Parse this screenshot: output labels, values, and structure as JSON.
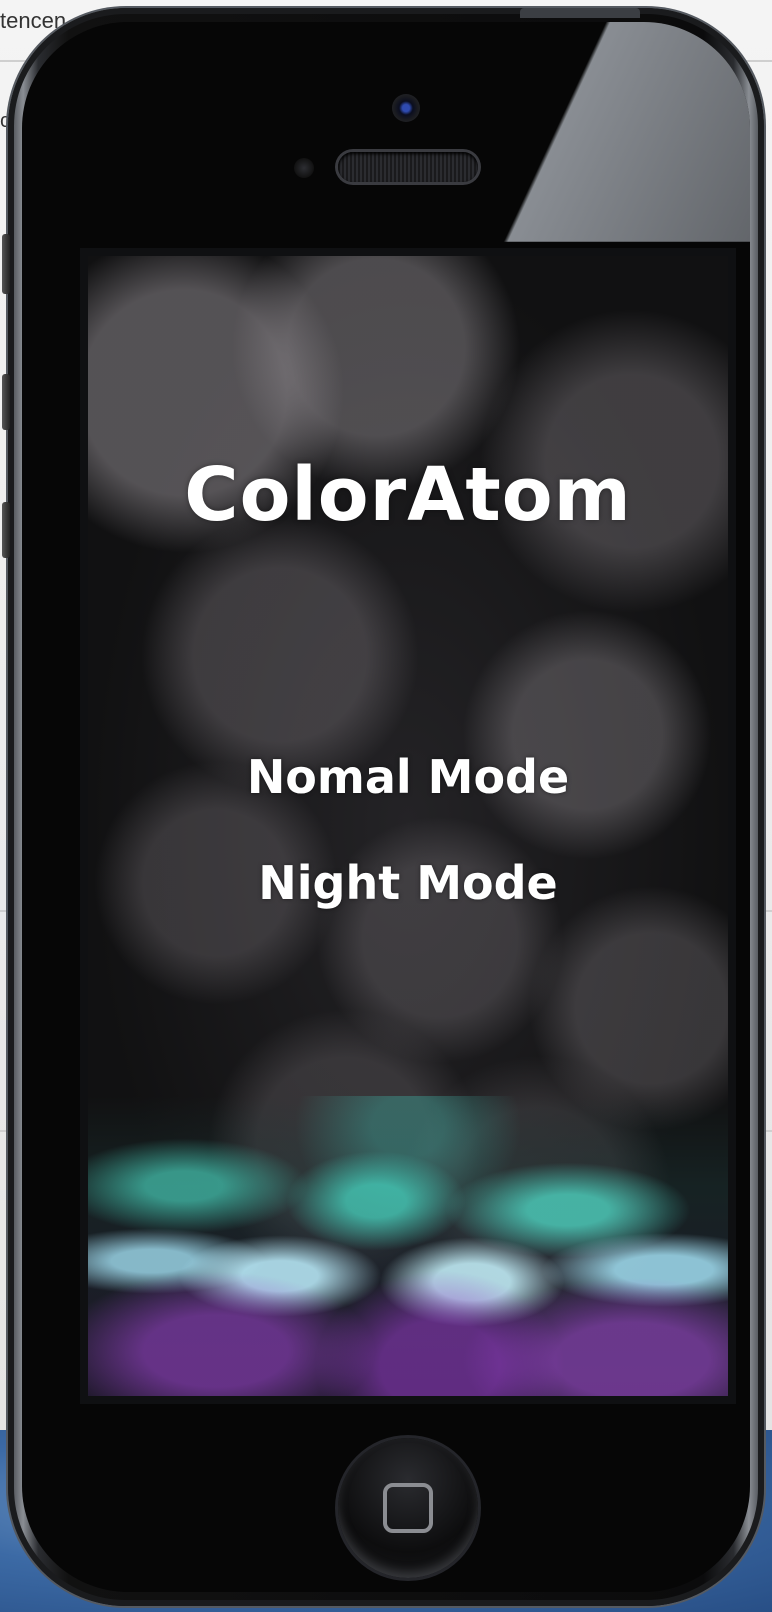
{
  "background": {
    "fragment_top": "tencen",
    "fragment_left": "c"
  },
  "app": {
    "title": "ColorAtom",
    "menu": [
      {
        "label": "Nomal Mode"
      },
      {
        "label": "Night Mode"
      }
    ]
  },
  "icons": {
    "home": "home-square-icon",
    "camera": "front-camera-icon",
    "speaker": "earpiece-speaker-icon"
  },
  "colors": {
    "text": "#ffffff",
    "particles_teal": "#50dcc8",
    "particles_purple": "#a050d2",
    "phone_body": "#0b0b0c"
  }
}
